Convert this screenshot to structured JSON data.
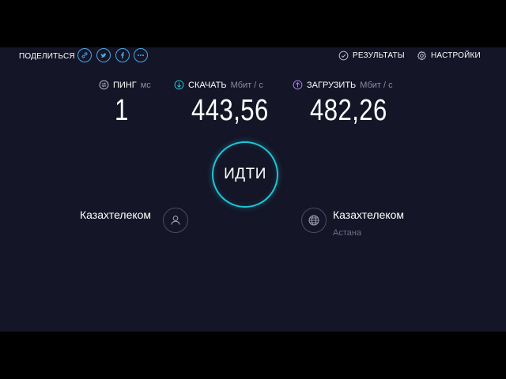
{
  "share": {
    "label": "ПОДЕЛИТЬСЯ",
    "icons": [
      "link-icon",
      "twitter-icon",
      "facebook-icon",
      "more-icon"
    ]
  },
  "header": {
    "results_label": "РЕЗУЛЬТАТЫ",
    "settings_label": "НАСТРОЙКИ"
  },
  "metrics": {
    "ping": {
      "label": "ПИНГ",
      "unit": "мс",
      "value": "1"
    },
    "download": {
      "label": "СКАЧАТЬ",
      "unit": "Мбит / с",
      "value": "443,56"
    },
    "upload": {
      "label": "ЗАГРУЗИТЬ",
      "unit": "Мбит / с",
      "value": "482,26"
    }
  },
  "go_button": {
    "label": "ИДТИ"
  },
  "provider": {
    "name": "Казахтелеком"
  },
  "server": {
    "name": "Казахтелеком",
    "location": "Астана"
  },
  "colors": {
    "background": "#141526",
    "accent": "#1fc5d6",
    "share_icon": "#4aa8e6",
    "download_icon": "#1fc5d6",
    "upload_icon": "#b07bf0"
  }
}
